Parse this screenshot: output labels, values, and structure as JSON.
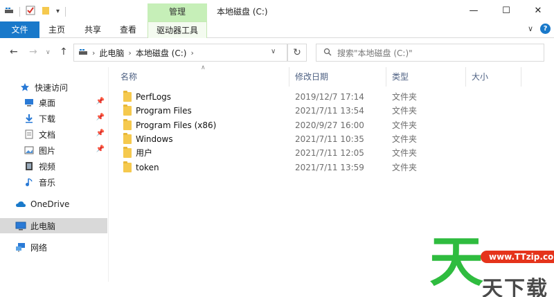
{
  "titlebar": {
    "tools_context": "管理",
    "window_title": "本地磁盘 (C:)",
    "minimize": "—",
    "maximize": "☐",
    "close": "✕"
  },
  "ribbon": {
    "tabs": [
      "文件",
      "主页",
      "共享",
      "查看",
      "驱动器工具"
    ],
    "collapse": "∨",
    "help": "?"
  },
  "address": {
    "crumbs": [
      "此电脑",
      "本地磁盘 (C:)"
    ],
    "search_placeholder": "搜索\"本地磁盘 (C:)\""
  },
  "sidebar": {
    "items": [
      {
        "label": "快速访问",
        "icon": "star-icon"
      },
      {
        "label": "桌面",
        "icon": "desktop-icon",
        "pinned": true
      },
      {
        "label": "下载",
        "icon": "download-icon",
        "pinned": true
      },
      {
        "label": "文档",
        "icon": "document-icon",
        "pinned": true
      },
      {
        "label": "图片",
        "icon": "picture-icon",
        "pinned": true
      },
      {
        "label": "视频",
        "icon": "video-icon"
      },
      {
        "label": "音乐",
        "icon": "music-icon"
      },
      {
        "label": "OneDrive",
        "icon": "cloud-icon"
      },
      {
        "label": "此电脑",
        "icon": "computer-icon"
      },
      {
        "label": "网络",
        "icon": "network-icon"
      }
    ]
  },
  "columns": {
    "name": "名称",
    "date": "修改日期",
    "type": "类型",
    "size": "大小"
  },
  "files": [
    {
      "name": "PerfLogs",
      "date": "2019/12/7 17:14",
      "type": "文件夹"
    },
    {
      "name": "Program Files",
      "date": "2021/7/11 13:54",
      "type": "文件夹"
    },
    {
      "name": "Program Files (x86)",
      "date": "2020/9/27 16:00",
      "type": "文件夹"
    },
    {
      "name": "Windows",
      "date": "2021/7/11 10:35",
      "type": "文件夹"
    },
    {
      "name": "用户",
      "date": "2021/7/11 12:05",
      "type": "文件夹"
    },
    {
      "name": "token",
      "date": "2021/7/11 13:59",
      "type": "文件夹"
    }
  ],
  "watermark": {
    "big_char": "天",
    "url": "www.TTzip.com",
    "small_text": "天下载"
  },
  "colors": {
    "file_tab": "#1979ca",
    "tools_context": "#c6efb8",
    "folder": "#f5c94e",
    "selected_nav": "#d9d9d9",
    "watermark_green": "#2fbc3f",
    "watermark_red": "#e5331b"
  }
}
